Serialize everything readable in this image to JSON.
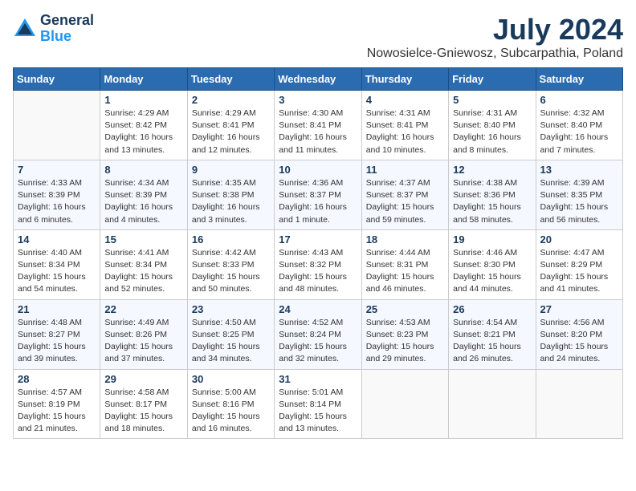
{
  "logo": {
    "general": "General",
    "blue": "Blue"
  },
  "title": "July 2024",
  "location": "Nowosielce-Gniewosz, Subcarpathia, Poland",
  "days_of_week": [
    "Sunday",
    "Monday",
    "Tuesday",
    "Wednesday",
    "Thursday",
    "Friday",
    "Saturday"
  ],
  "weeks": [
    [
      {
        "day": "",
        "info": ""
      },
      {
        "day": "1",
        "info": "Sunrise: 4:29 AM\nSunset: 8:42 PM\nDaylight: 16 hours\nand 13 minutes."
      },
      {
        "day": "2",
        "info": "Sunrise: 4:29 AM\nSunset: 8:41 PM\nDaylight: 16 hours\nand 12 minutes."
      },
      {
        "day": "3",
        "info": "Sunrise: 4:30 AM\nSunset: 8:41 PM\nDaylight: 16 hours\nand 11 minutes."
      },
      {
        "day": "4",
        "info": "Sunrise: 4:31 AM\nSunset: 8:41 PM\nDaylight: 16 hours\nand 10 minutes."
      },
      {
        "day": "5",
        "info": "Sunrise: 4:31 AM\nSunset: 8:40 PM\nDaylight: 16 hours\nand 8 minutes."
      },
      {
        "day": "6",
        "info": "Sunrise: 4:32 AM\nSunset: 8:40 PM\nDaylight: 16 hours\nand 7 minutes."
      }
    ],
    [
      {
        "day": "7",
        "info": "Sunrise: 4:33 AM\nSunset: 8:39 PM\nDaylight: 16 hours\nand 6 minutes."
      },
      {
        "day": "8",
        "info": "Sunrise: 4:34 AM\nSunset: 8:39 PM\nDaylight: 16 hours\nand 4 minutes."
      },
      {
        "day": "9",
        "info": "Sunrise: 4:35 AM\nSunset: 8:38 PM\nDaylight: 16 hours\nand 3 minutes."
      },
      {
        "day": "10",
        "info": "Sunrise: 4:36 AM\nSunset: 8:37 PM\nDaylight: 16 hours\nand 1 minute."
      },
      {
        "day": "11",
        "info": "Sunrise: 4:37 AM\nSunset: 8:37 PM\nDaylight: 15 hours\nand 59 minutes."
      },
      {
        "day": "12",
        "info": "Sunrise: 4:38 AM\nSunset: 8:36 PM\nDaylight: 15 hours\nand 58 minutes."
      },
      {
        "day": "13",
        "info": "Sunrise: 4:39 AM\nSunset: 8:35 PM\nDaylight: 15 hours\nand 56 minutes."
      }
    ],
    [
      {
        "day": "14",
        "info": "Sunrise: 4:40 AM\nSunset: 8:34 PM\nDaylight: 15 hours\nand 54 minutes."
      },
      {
        "day": "15",
        "info": "Sunrise: 4:41 AM\nSunset: 8:34 PM\nDaylight: 15 hours\nand 52 minutes."
      },
      {
        "day": "16",
        "info": "Sunrise: 4:42 AM\nSunset: 8:33 PM\nDaylight: 15 hours\nand 50 minutes."
      },
      {
        "day": "17",
        "info": "Sunrise: 4:43 AM\nSunset: 8:32 PM\nDaylight: 15 hours\nand 48 minutes."
      },
      {
        "day": "18",
        "info": "Sunrise: 4:44 AM\nSunset: 8:31 PM\nDaylight: 15 hours\nand 46 minutes."
      },
      {
        "day": "19",
        "info": "Sunrise: 4:46 AM\nSunset: 8:30 PM\nDaylight: 15 hours\nand 44 minutes."
      },
      {
        "day": "20",
        "info": "Sunrise: 4:47 AM\nSunset: 8:29 PM\nDaylight: 15 hours\nand 41 minutes."
      }
    ],
    [
      {
        "day": "21",
        "info": "Sunrise: 4:48 AM\nSunset: 8:27 PM\nDaylight: 15 hours\nand 39 minutes."
      },
      {
        "day": "22",
        "info": "Sunrise: 4:49 AM\nSunset: 8:26 PM\nDaylight: 15 hours\nand 37 minutes."
      },
      {
        "day": "23",
        "info": "Sunrise: 4:50 AM\nSunset: 8:25 PM\nDaylight: 15 hours\nand 34 minutes."
      },
      {
        "day": "24",
        "info": "Sunrise: 4:52 AM\nSunset: 8:24 PM\nDaylight: 15 hours\nand 32 minutes."
      },
      {
        "day": "25",
        "info": "Sunrise: 4:53 AM\nSunset: 8:23 PM\nDaylight: 15 hours\nand 29 minutes."
      },
      {
        "day": "26",
        "info": "Sunrise: 4:54 AM\nSunset: 8:21 PM\nDaylight: 15 hours\nand 26 minutes."
      },
      {
        "day": "27",
        "info": "Sunrise: 4:56 AM\nSunset: 8:20 PM\nDaylight: 15 hours\nand 24 minutes."
      }
    ],
    [
      {
        "day": "28",
        "info": "Sunrise: 4:57 AM\nSunset: 8:19 PM\nDaylight: 15 hours\nand 21 minutes."
      },
      {
        "day": "29",
        "info": "Sunrise: 4:58 AM\nSunset: 8:17 PM\nDaylight: 15 hours\nand 18 minutes."
      },
      {
        "day": "30",
        "info": "Sunrise: 5:00 AM\nSunset: 8:16 PM\nDaylight: 15 hours\nand 16 minutes."
      },
      {
        "day": "31",
        "info": "Sunrise: 5:01 AM\nSunset: 8:14 PM\nDaylight: 15 hours\nand 13 minutes."
      },
      {
        "day": "",
        "info": ""
      },
      {
        "day": "",
        "info": ""
      },
      {
        "day": "",
        "info": ""
      }
    ]
  ]
}
